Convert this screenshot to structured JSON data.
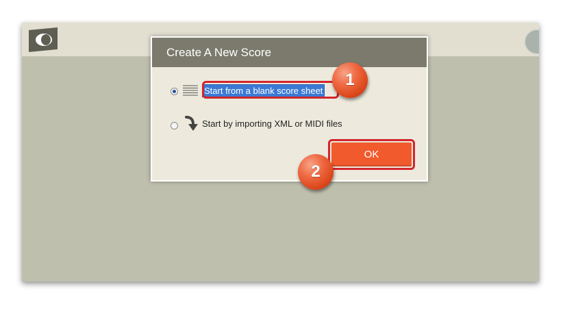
{
  "modal": {
    "title": "Create A New Score",
    "options": [
      {
        "label": "Start from a blank score sheet",
        "selected": true,
        "icon": "staff-lines-icon"
      },
      {
        "label": "Start by importing XML or MIDI files",
        "selected": false,
        "icon": "curved-arrow-down-icon"
      }
    ],
    "ok_label": "OK"
  },
  "annotations": {
    "step1": "1",
    "step2": "2"
  },
  "colors": {
    "header": "#7b7a6d",
    "dialog_bg": "#edeadd",
    "ok_button": "#f05a2d",
    "highlight_border": "#d3252c",
    "badge": "#e9582c",
    "selection": "#3b79d4",
    "app_bg": "#bfbfae",
    "topbar": "#e2dfd1"
  }
}
